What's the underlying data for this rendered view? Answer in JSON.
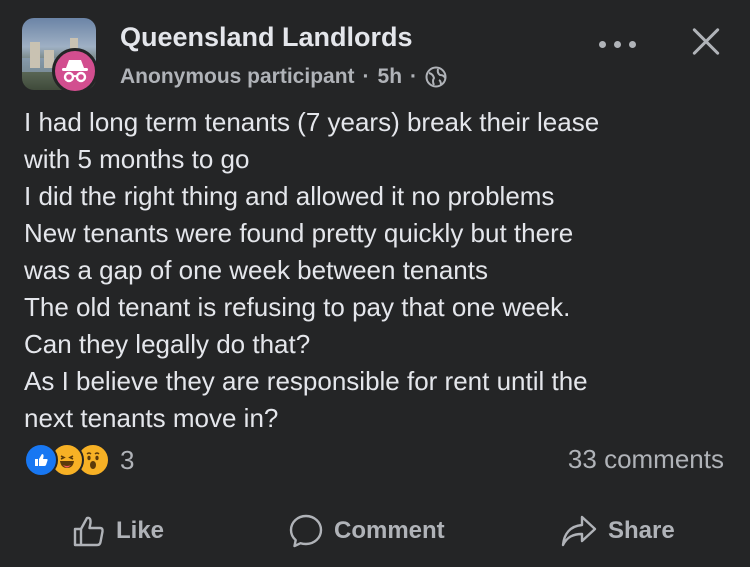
{
  "post": {
    "group_name": "Queensland Landlords",
    "author": "Anonymous participant",
    "time": "5h",
    "separator": "·",
    "body_lines": [
      "I had long term tenants (7 years) break their lease",
      "with 5 months to go",
      "I did the right thing and allowed it no problems",
      "New tenants were found pretty quickly but there",
      "was a gap of one week between tenants",
      "The old tenant is refusing to pay that one week.",
      "Can they legally do that?",
      "As I believe they are responsible for rent until the",
      "next tenants move in?"
    ]
  },
  "reactions": {
    "types": [
      "like-icon",
      "haha-icon",
      "wow-icon"
    ],
    "count": "3",
    "comments_label": "33 comments"
  },
  "actions": {
    "like_label": "Like",
    "comment_label": "Comment",
    "share_label": "Share"
  },
  "colors": {
    "background": "#242526",
    "text_primary": "#e4e6eb",
    "text_secondary": "#b0b3b8",
    "like_blue": "#1877f2",
    "reaction_yellow": "#f7b125",
    "anon_pink": "#d24e8f"
  }
}
